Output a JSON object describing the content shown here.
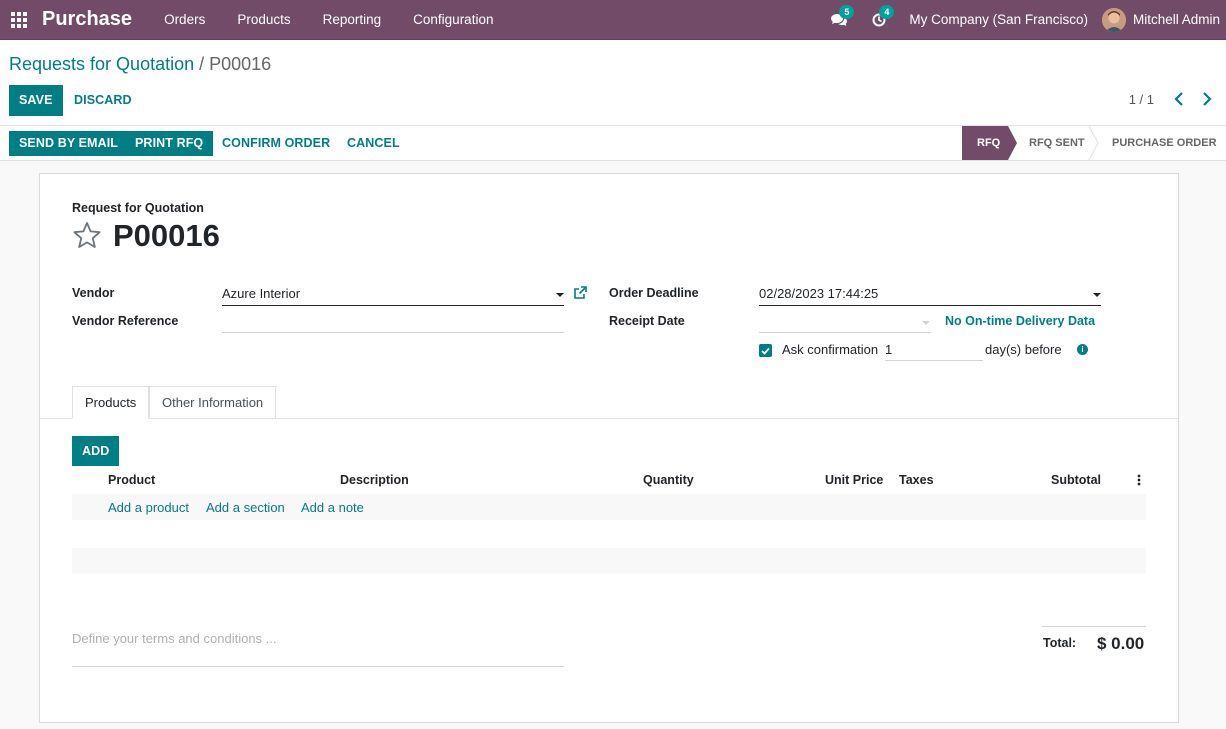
{
  "navbar": {
    "app_name": "Purchase",
    "menu": [
      "Orders",
      "Products",
      "Reporting",
      "Configuration"
    ],
    "messages_count": "5",
    "activities_count": "4",
    "company": "My Company (San Francisco)",
    "user": "Mitchell Admin"
  },
  "breadcrumb": {
    "parent": "Requests for Quotation",
    "separator": " / ",
    "current": "P00016"
  },
  "actions": {
    "save": "SAVE",
    "discard": "DISCARD",
    "pager": "1 / 1"
  },
  "statusbar": {
    "buttons": [
      "SEND BY EMAIL",
      "PRINT RFQ",
      "CONFIRM ORDER",
      "CANCEL"
    ],
    "stages": [
      "RFQ",
      "RFQ SENT",
      "PURCHASE ORDER"
    ],
    "active_stage": "RFQ"
  },
  "form": {
    "doc_type": "Request for Quotation",
    "name": "P00016",
    "vendor_label": "Vendor",
    "vendor_value": "Azure Interior",
    "vendor_ref_label": "Vendor Reference",
    "vendor_ref_value": "",
    "order_deadline_label": "Order Deadline",
    "order_deadline_value": "02/28/2023 17:44:25",
    "receipt_date_label": "Receipt Date",
    "receipt_date_value": "",
    "ontime_link": "No On-time Delivery Data",
    "ask_confirmation_label": "Ask confirmation",
    "ask_confirmation_checked": true,
    "ask_days_value": "1",
    "ask_days_suffix": "day(s) before"
  },
  "tabs": [
    "Products",
    "Other Information"
  ],
  "active_tab": "Products",
  "lines": {
    "add_label": "ADD",
    "columns": [
      "Product",
      "Description",
      "Quantity",
      "Unit Price",
      "Taxes",
      "Subtotal"
    ],
    "add_links": [
      "Add a product",
      "Add a section",
      "Add a note"
    ]
  },
  "footer": {
    "terms_placeholder": "Define your terms and conditions ...",
    "total_label": "Total:",
    "total_value": "$ 0.00"
  },
  "colors": {
    "brand": "#714b67",
    "accent": "#017e84"
  }
}
